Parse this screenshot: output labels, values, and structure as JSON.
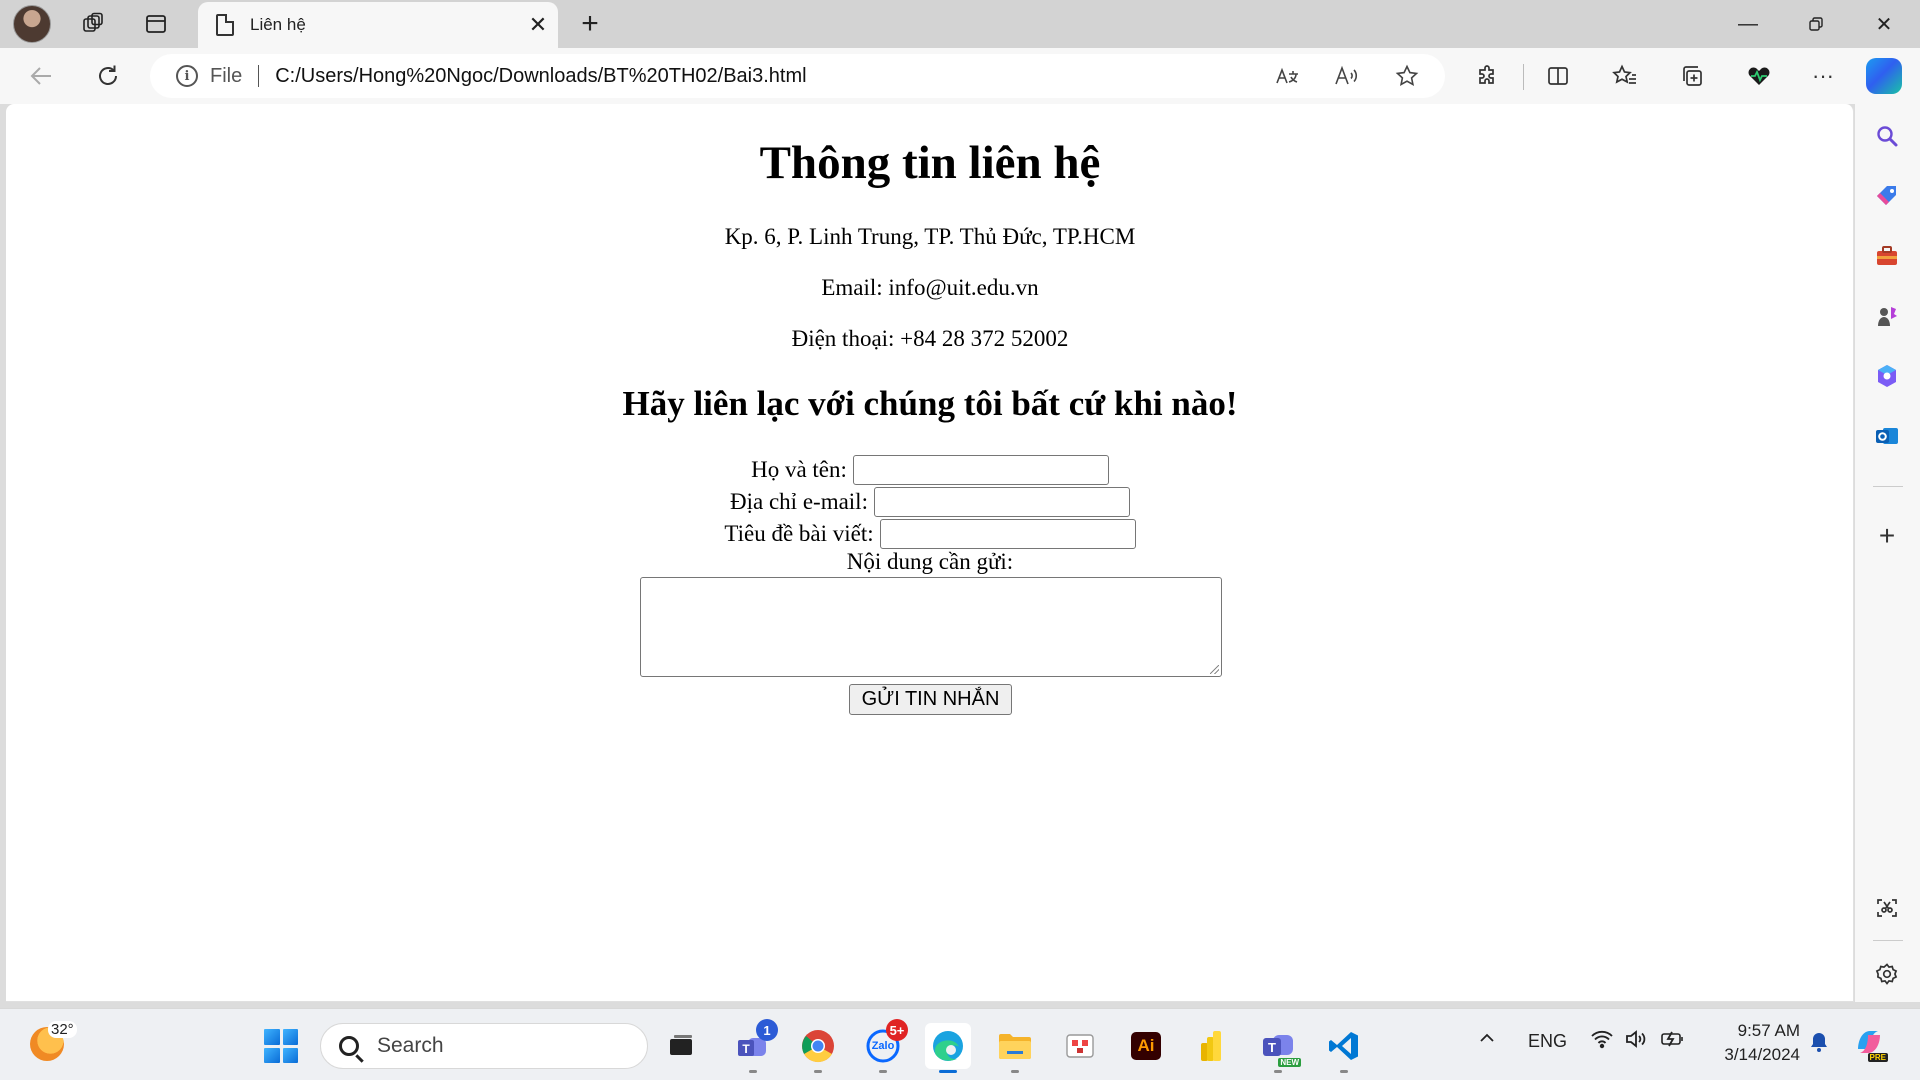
{
  "browser": {
    "tab_title": "Liên hệ",
    "url_scheme": "File",
    "url": "C:/Users/Hong%20Ngoc/Downloads/BT%20TH02/Bai3.html"
  },
  "page": {
    "title": "Thông tin liên hệ",
    "address": "Kp. 6, P. Linh Trung, TP. Thủ Đức, TP.HCM",
    "email": "Email: info@uit.edu.vn",
    "phone": "Điện thoại: +84 28 372 52002",
    "subtitle": "Hãy liên lạc với chúng tôi bất cứ khi nào!",
    "form": {
      "name_label": "Họ và tên:",
      "name_value": "",
      "email_label": "Địa chỉ e-mail:",
      "email_value": "",
      "subject_label": "Tiêu đề bài viết:",
      "subject_value": "",
      "message_label": "Nội dung cần gửi:",
      "message_value": "",
      "submit_label": "GỬI TIN NHẮN"
    }
  },
  "taskbar": {
    "weather_temp": "32°",
    "search_placeholder": "Search",
    "teams_badge": "1",
    "zalo_badge": "5+",
    "zalo_label": "Zalo",
    "illustrator_label": "Ai",
    "teams_new_label": "NEW",
    "language": "ENG",
    "time": "9:57 AM",
    "date": "3/14/2024",
    "copilot_label": "PRE"
  }
}
